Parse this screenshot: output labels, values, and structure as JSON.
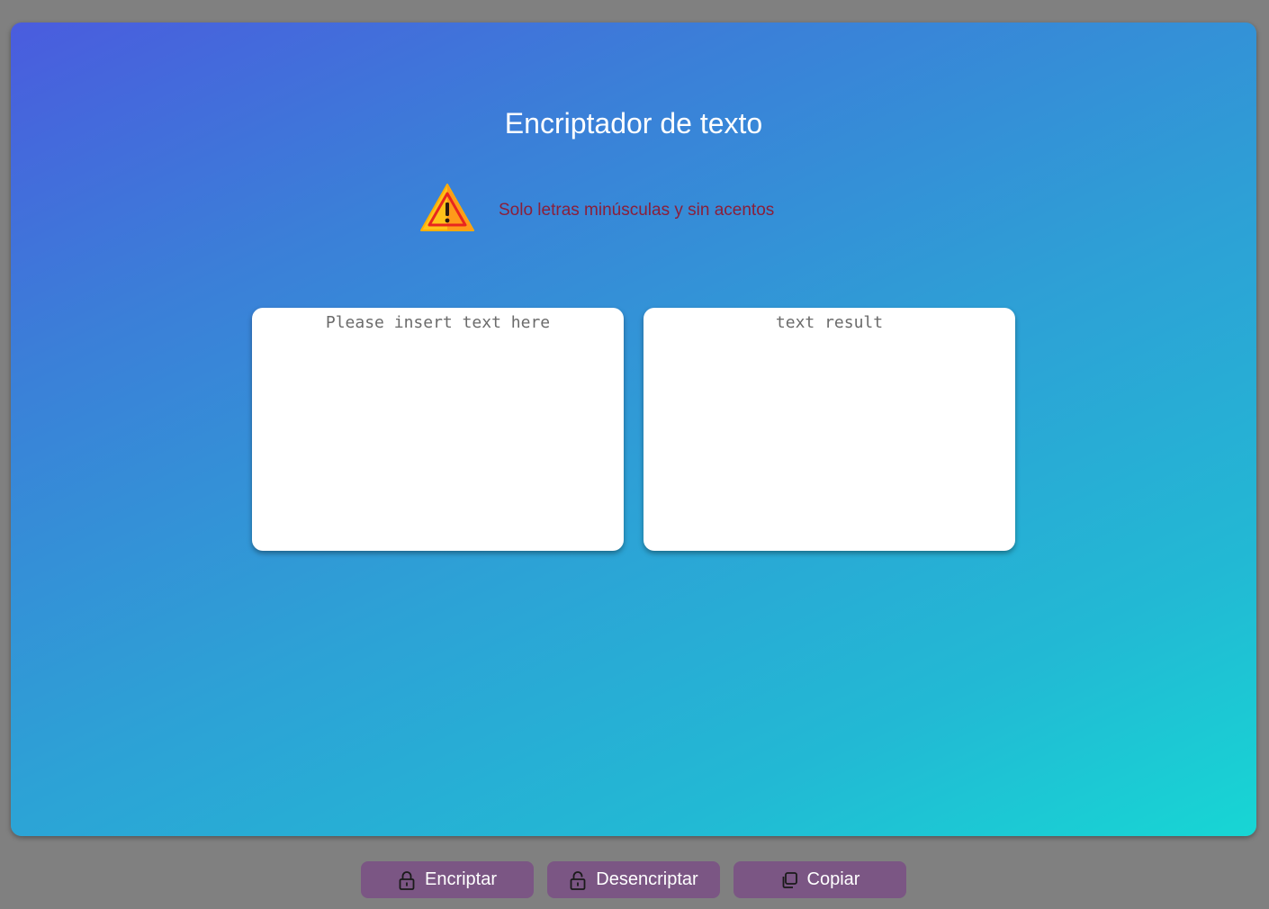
{
  "header": {
    "title": "Encriptador de texto"
  },
  "warning": {
    "icon": "warning-triangle-icon",
    "text": "Solo letras minúsculas y sin acentos",
    "color": "#8a1f3a"
  },
  "input": {
    "placeholder": "Please insert text here",
    "value": ""
  },
  "output": {
    "placeholder": "text result",
    "value": ""
  },
  "buttons": {
    "encrypt": {
      "label": "Encriptar",
      "icon": "lock-icon"
    },
    "decrypt": {
      "label": "Desencriptar",
      "icon": "unlock-icon"
    },
    "copy": {
      "label": "Copiar",
      "icon": "copy-icon"
    }
  },
  "colors": {
    "background": "#808080",
    "gradient_start": "#4a5cde",
    "gradient_end": "#17d6d4",
    "button": "#7b5684"
  }
}
